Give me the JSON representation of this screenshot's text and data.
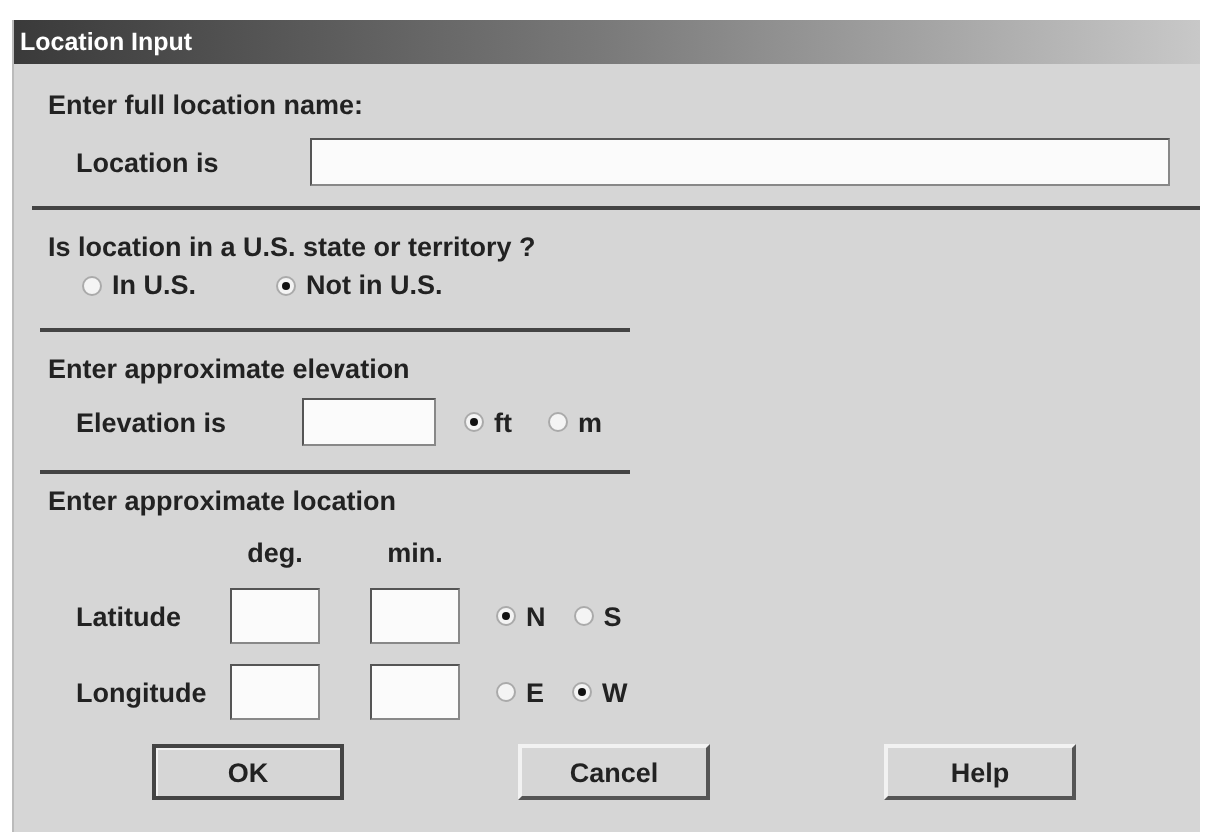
{
  "window": {
    "title": "Location Input"
  },
  "name_section": {
    "heading": "Enter full location name:",
    "label": "Location is"
  },
  "us_section": {
    "heading": "Is location in a U.S. state or territory ?",
    "options": [
      {
        "label": "In U.S.",
        "selected": false
      },
      {
        "label": "Not in U.S.",
        "selected": true
      }
    ]
  },
  "elevation_section": {
    "heading": "Enter approximate elevation",
    "label": "Elevation is",
    "units": [
      {
        "label": "ft",
        "selected": true
      },
      {
        "label": "m",
        "selected": false
      }
    ]
  },
  "location_section": {
    "heading": "Enter approximate location",
    "columns": [
      "deg.",
      "min."
    ],
    "rows": [
      {
        "label": "Latitude",
        "options": [
          {
            "label": "N",
            "selected": true
          },
          {
            "label": "S",
            "selected": false
          }
        ]
      },
      {
        "label": "Longitude",
        "options": [
          {
            "label": "E",
            "selected": false
          },
          {
            "label": "W",
            "selected": true
          }
        ]
      }
    ]
  },
  "buttons": [
    {
      "label": "OK",
      "default": true
    },
    {
      "label": "Cancel",
      "default": false
    },
    {
      "label": "Help",
      "default": false
    }
  ]
}
